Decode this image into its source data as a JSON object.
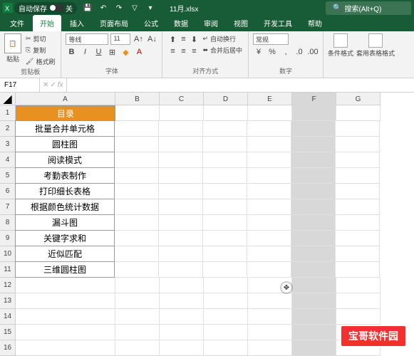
{
  "titlebar": {
    "autosave_label": "自动保存",
    "autosave_state": "关",
    "filename": "11月.xlsx",
    "search_placeholder": "搜索(Alt+Q)"
  },
  "tabs": {
    "file": "文件",
    "home": "开始",
    "insert": "插入",
    "layout": "页面布局",
    "formulas": "公式",
    "data": "数据",
    "review": "审阅",
    "view": "视图",
    "dev": "开发工具",
    "help": "帮助"
  },
  "ribbon": {
    "clipboard": {
      "paste": "粘贴",
      "cut": "剪切",
      "copy": "复制",
      "format": "格式刷",
      "label": "剪贴板"
    },
    "font": {
      "name": "等线",
      "size": "11",
      "label": "字体"
    },
    "alignment": {
      "wrap": "自动换行",
      "merge": "合并后居中",
      "label": "对齐方式"
    },
    "number": {
      "format": "常规",
      "label": "数字"
    },
    "styles": {
      "cond": "条件格式",
      "table": "套用表格格式"
    }
  },
  "formula_bar": {
    "cell_ref": "F17",
    "value": ""
  },
  "columns": [
    "A",
    "B",
    "C",
    "D",
    "E",
    "F",
    "G"
  ],
  "rows": [
    "1",
    "2",
    "3",
    "4",
    "5",
    "6",
    "7",
    "8",
    "9",
    "10",
    "11",
    "12",
    "13",
    "14",
    "15",
    "16"
  ],
  "cells": {
    "a1": "目录",
    "a2": "批量合并单元格",
    "a3": "圆柱图",
    "a4": "阅读模式",
    "a5": "考勤表制作",
    "a6": "打印细长表格",
    "a7": "根据颜色统计数据",
    "a8": "漏斗图",
    "a9": "关键字求和",
    "a10": "近似匹配",
    "a11": "三维圆柱图"
  },
  "watermark": "宝哥软件园"
}
